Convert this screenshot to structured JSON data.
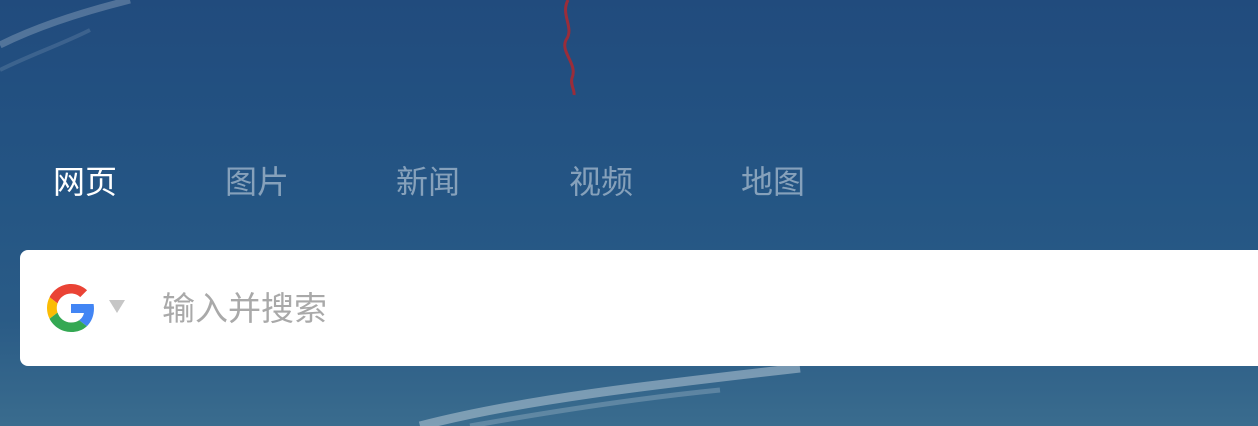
{
  "tabs": [
    {
      "label": "网页",
      "active": true
    },
    {
      "label": "图片",
      "active": false
    },
    {
      "label": "新闻",
      "active": false
    },
    {
      "label": "视频",
      "active": false
    },
    {
      "label": "地图",
      "active": false
    }
  ],
  "search": {
    "engine_icon": "google-g-icon",
    "dropdown_icon": "caret-down-icon",
    "placeholder": "输入并搜索",
    "value": ""
  },
  "colors": {
    "background": "#245584",
    "tab_active": "#ffffff",
    "tab_inactive": "#9aaec6",
    "search_box": "#ffffff",
    "placeholder": "#a9a9a9"
  }
}
